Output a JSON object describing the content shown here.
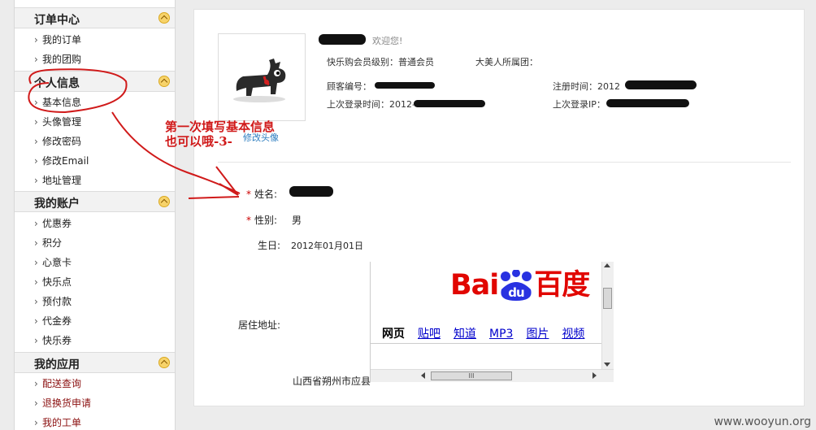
{
  "sidebar": {
    "sections": [
      {
        "title": "订单中心",
        "items": [
          "我的订单",
          "我的团购"
        ]
      },
      {
        "title": "个人信息",
        "items": [
          "基本信息",
          "头像管理",
          "修改密码",
          "修改Email",
          "地址管理"
        ]
      },
      {
        "title": "我的账户",
        "items": [
          "优惠券",
          "积分",
          "心意卡",
          "快乐点",
          "预付款",
          "代金券",
          "快乐券"
        ]
      },
      {
        "title": "我的应用",
        "items": [
          "配送查询",
          "退换货申请",
          "我的工单"
        ]
      }
    ]
  },
  "profile": {
    "welcome": "欢迎您!",
    "member_level_label": "快乐购会员级别：",
    "member_level_value": "普通会员",
    "group_label": "大美人所属团：",
    "customer_no_label": "顾客编号：",
    "register_time_label": "注册时间：",
    "register_time_prefix": "2012",
    "last_login_time_label": "上次登录时间：",
    "last_login_time_prefix": "2012-",
    "last_login_ip_label": "上次登录IP：",
    "change_avatar_link": "修改头像"
  },
  "form": {
    "name_label": "姓名:",
    "gender_label": "性别:",
    "gender_value": "男",
    "birthday_label": "生日:",
    "birthday_value": "2012年01月01日",
    "address_label": "居住地址:",
    "address_value": "山西省朔州市应县"
  },
  "embedded_frame": {
    "logo_left": "Bai",
    "logo_paw": "du",
    "logo_right": "百度",
    "nav": [
      "网页",
      "贴吧",
      "知道",
      "MP3",
      "图片",
      "视频"
    ],
    "hscroll_grip": "III"
  },
  "annotation": {
    "line1": "第一次填写基本信息",
    "line2": "也可以哦-3-"
  },
  "watermark": "www.wooyun.org",
  "colors": {
    "accent_red": "#d01a1a",
    "baidu_red": "#e10601",
    "baidu_blue": "#2932e1",
    "link": "#2b7cbf"
  }
}
